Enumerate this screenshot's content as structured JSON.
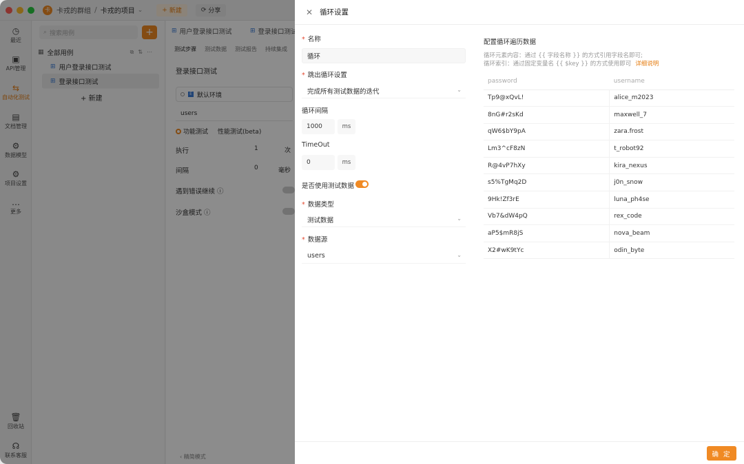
{
  "topbar": {
    "team_name": "卡戎的群组",
    "separator": "/",
    "project_name": "卡戎的项目",
    "new_label": "新建",
    "share_label": "分享"
  },
  "nav": {
    "items": [
      {
        "label": "最近",
        "icon": "clock-icon"
      },
      {
        "label": "API管理",
        "icon": "api-icon"
      },
      {
        "label": "自动化测试",
        "icon": "automation-icon"
      },
      {
        "label": "文档管理",
        "icon": "document-icon"
      },
      {
        "label": "数据模型",
        "icon": "model-icon"
      },
      {
        "label": "项目设置",
        "icon": "settings-icon"
      },
      {
        "label": "更多",
        "icon": "more-icon"
      }
    ],
    "bottom": [
      {
        "label": "回收站",
        "icon": "trash-icon"
      },
      {
        "label": "联系客服",
        "icon": "headset-icon"
      }
    ]
  },
  "tree": {
    "search_placeholder": "搜索用例",
    "root_label": "全部用例",
    "items": [
      "用户登录接口测试",
      "登录接口测试"
    ],
    "new_label": "新建"
  },
  "main": {
    "tabs": [
      "用户登录接口测试",
      "登录接口测试"
    ],
    "subtabs": [
      "测试步骤",
      "测试数据",
      "测试报告",
      "持续集成"
    ],
    "title": "登录接口测试",
    "env": "默认环境",
    "dataset": "users",
    "mode_functional": "功能测试",
    "mode_performance": "性能测试(beta)",
    "exec_label": "执行",
    "exec_value": "1",
    "exec_unit": "次",
    "interval_label": "间隔",
    "interval_value": "0",
    "interval_unit": "毫秒",
    "error_continue": "遇到错误继续",
    "sandbox": "沙盒模式",
    "footer": "精简模式"
  },
  "drawer": {
    "title": "循环设置",
    "name_label": "名称",
    "name_value": "循环",
    "break_label": "跳出循环设置",
    "break_value": "完成所有测试数据的迭代",
    "interval_label": "循环间隔",
    "interval_value": "1000",
    "interval_unit": "ms",
    "timeout_label": "TimeOut",
    "timeout_value": "0",
    "timeout_unit": "ms",
    "use_test_data_label": "是否使用测试数据",
    "data_type_label": "数据类型",
    "data_type_value": "测试数据",
    "data_source_label": "数据源",
    "data_source_value": "users",
    "right_title": "配置循环遍历数据",
    "hint_line1": "循环元素内容：通过 {{ 字段名称 }} 的方式引用字段名即可;",
    "hint_line2": "循环索引：通过固定变量名 {{ $key }} 的方式使用即可",
    "hint_link": "详细说明",
    "ok_label": "确 定"
  },
  "table": {
    "columns": [
      "password",
      "username"
    ],
    "rows": [
      [
        "Tp9@xQvL!",
        "alice_m2023"
      ],
      [
        "8nG#r2sKd",
        "maxwell_7"
      ],
      [
        "qW6$bY9pA",
        "zara.frost"
      ],
      [
        "Lm3^cF8zN",
        "t_robot92"
      ],
      [
        "R@4vP7hXy",
        "kira_nexus"
      ],
      [
        "s5%TgMq2D",
        "j0n_snow"
      ],
      [
        "9Hk!Zf3rE",
        "luna_ph4se"
      ],
      [
        "Vb7&dW4pQ",
        "rex_code"
      ],
      [
        "aP5$mR8jS",
        "nova_beam"
      ],
      [
        "X2#wK9tYc",
        "odin_byte"
      ]
    ]
  },
  "colors": {
    "accent": "#f08a24",
    "required": "#e5482f",
    "link": "#e57d12"
  }
}
